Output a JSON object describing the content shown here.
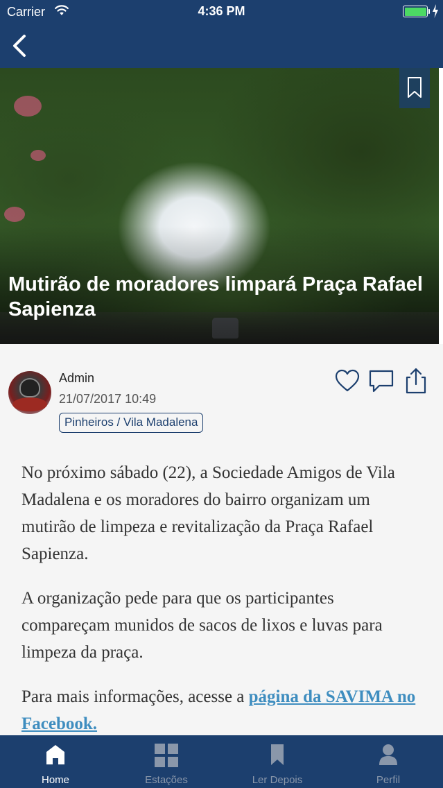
{
  "status_bar": {
    "carrier": "Carrier",
    "time": "4:36 PM"
  },
  "nav": {
    "back_icon": "chevron-left-icon"
  },
  "post": {
    "title": "Mutirão de moradores limpará Praça Rafael Sapienza",
    "author": "Admin",
    "date": "21/07/2017 10:49",
    "tag": "Pinheiros / Vila Madalena",
    "paragraphs": [
      "No próximo sábado (22), a Sociedade Amigos de Vila Madalena e os moradores do bairro organizam um mutirão de limpeza e revitalização da Praça Rafael Sapienza.",
      "A organização pede para que os participantes compareçam munidos de sacos de lixos e luvas para limpeza da praça."
    ],
    "link_intro": "Para mais informações, acesse a ",
    "link_text": "página da SAVIMA no Facebook. "
  },
  "actions": {
    "like_icon": "heart-icon",
    "comment_icon": "comment-icon",
    "share_icon": "share-icon",
    "bookmark_icon": "bookmark-icon"
  },
  "tabs": [
    {
      "label": "Home",
      "icon": "home-icon",
      "active": true
    },
    {
      "label": "Estações",
      "icon": "grid-icon",
      "active": false
    },
    {
      "label": "Ler Depois",
      "icon": "bookmark-icon",
      "active": false
    },
    {
      "label": "Perfil",
      "icon": "person-icon",
      "active": false
    }
  ],
  "colors": {
    "primary": "#1c3f6e",
    "link": "#3e8dbf",
    "battery": "#4cd964",
    "tab_inactive": "#8a97aa"
  }
}
